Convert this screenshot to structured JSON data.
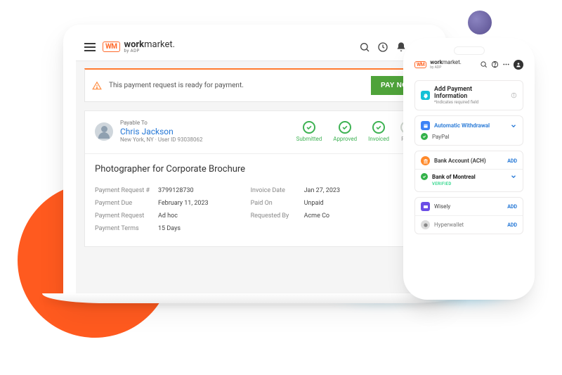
{
  "brand": {
    "badge": "WM",
    "name_a": "work",
    "name_b": "market",
    "byline": "by ADP"
  },
  "banner": {
    "text": "This payment request is ready for payment.",
    "cta": "PAY NOW"
  },
  "payee": {
    "label": "Payable To",
    "name": "Chris Jackson",
    "meta": "New York, NY · User ID 93038062"
  },
  "steps": [
    {
      "label": "Submitted"
    },
    {
      "label": "Approved"
    },
    {
      "label": "Invoiced"
    },
    {
      "label": "Paid"
    }
  ],
  "assignment_title": "Photographer for Corporate Brochure",
  "details_left": [
    {
      "k": "Payment Request #",
      "v": "3799128730"
    },
    {
      "k": "Payment Due",
      "v": "February 11, 2023"
    },
    {
      "k": "Payment Request",
      "v": "Ad hoc"
    },
    {
      "k": "Payment Terms",
      "v": "15 Days"
    }
  ],
  "details_right": [
    {
      "k": "Invoice Date",
      "v": "Jan 27, 2023"
    },
    {
      "k": "Paid On",
      "v": "Unpaid"
    },
    {
      "k": "Requested By",
      "v": "Acme Co"
    }
  ],
  "phone": {
    "header": {
      "title": "Add Payment Information",
      "sub": "*Indicates required field"
    },
    "auto": {
      "title": "Automatic Withdrawal",
      "sub": "PayPal"
    },
    "bank_section": {
      "title": "Bank Account (ACH)",
      "cta": "ADD"
    },
    "bank": {
      "name": "Bank of Montreal",
      "status": "VERIFIED"
    },
    "options": [
      {
        "name": "Wisely",
        "cta": "ADD",
        "color": "#6b4de6"
      },
      {
        "name": "Hyperwallet",
        "cta": "ADD",
        "color": "#bbb"
      }
    ]
  }
}
